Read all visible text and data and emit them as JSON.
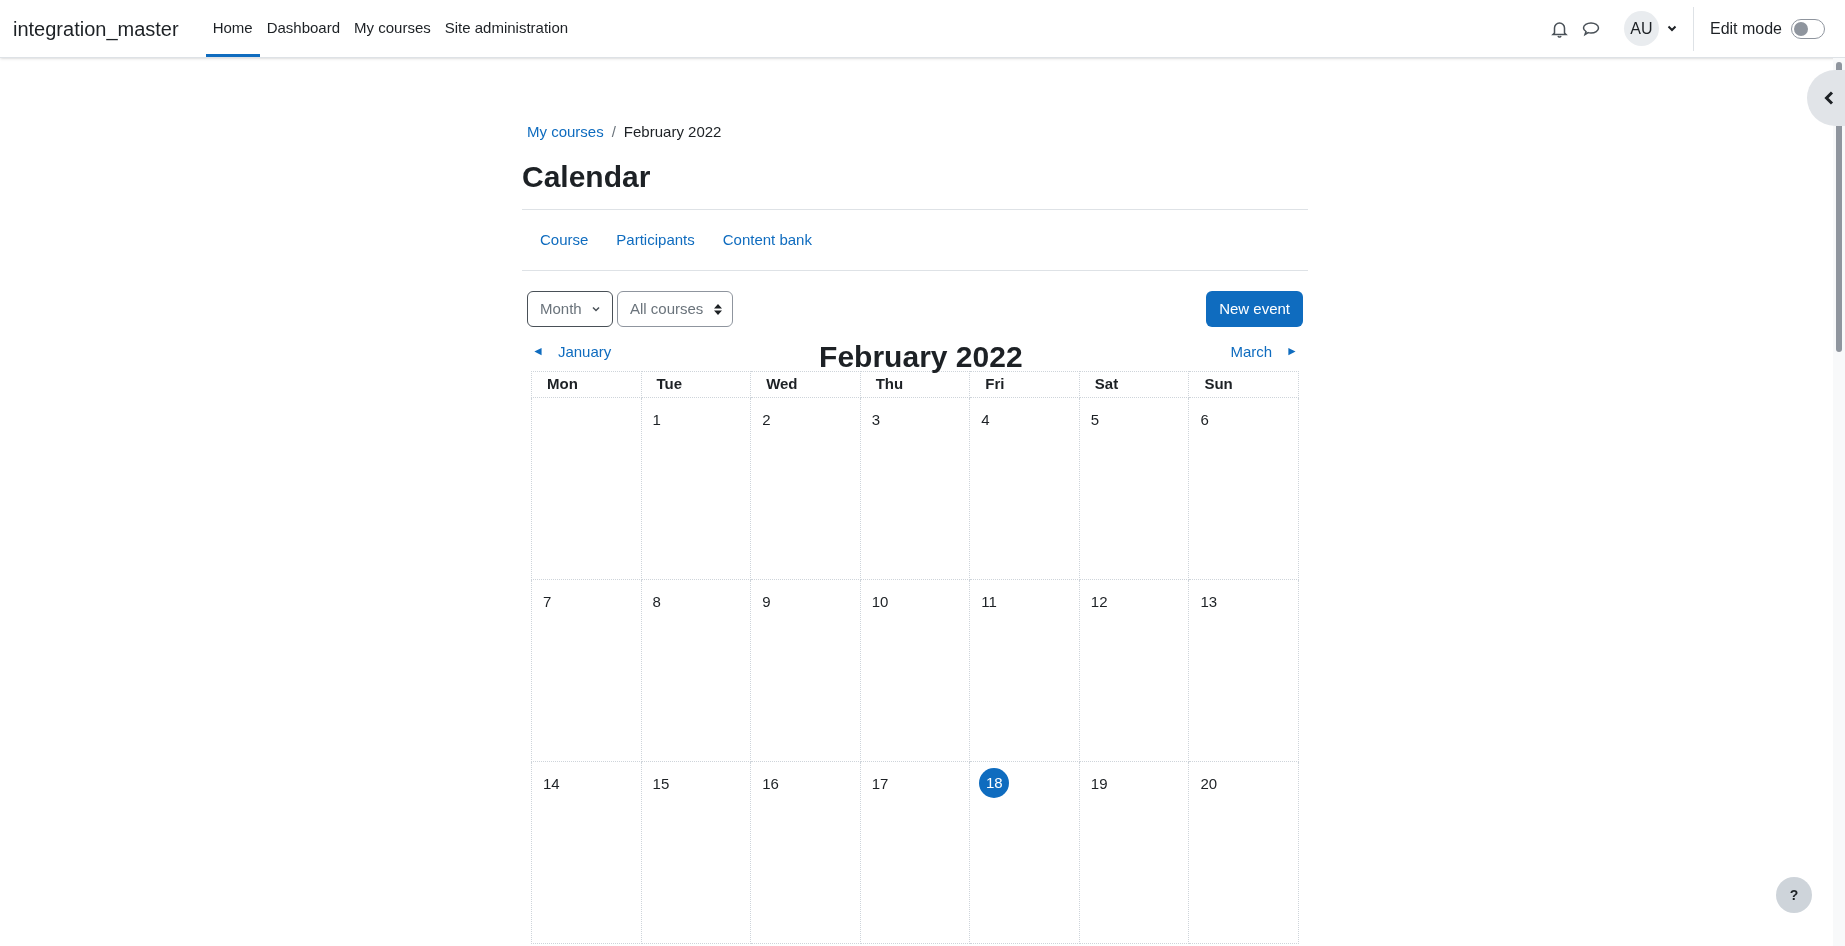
{
  "navbar": {
    "site_name": "integration_master",
    "links": [
      {
        "label": "Home",
        "selected": true
      },
      {
        "label": "Dashboard",
        "selected": false
      },
      {
        "label": "My courses",
        "selected": false
      },
      {
        "label": "Site administration",
        "selected": false
      }
    ],
    "user_initials": "AU",
    "edit_mode": {
      "label": "Edit mode",
      "on": false
    }
  },
  "breadcrumb": [
    {
      "label": "My courses",
      "kind": "link"
    },
    {
      "label": "February 2022",
      "kind": "current"
    }
  ],
  "breadcrumb_separator": "/",
  "heading": "Calendar",
  "secondary_nav": [
    {
      "label": "Course"
    },
    {
      "label": "Participants"
    },
    {
      "label": "Content bank"
    }
  ],
  "view_select": {
    "value": "Month"
  },
  "course_select": {
    "value": "All courses"
  },
  "new_event_button": "New event",
  "month_nav": {
    "prev_arrow": "◄",
    "prev": "January",
    "title": "February 2022",
    "next": "March",
    "next_arrow": "►"
  },
  "weekdays": [
    "Mon",
    "Tue",
    "Wed",
    "Thu",
    "Fri",
    "Sat",
    "Sun"
  ],
  "weeks": [
    [
      {
        "kind": "blank"
      },
      {
        "kind": "day",
        "label": "1",
        "today": false
      },
      {
        "kind": "day",
        "label": "2",
        "today": false
      },
      {
        "kind": "day",
        "label": "3",
        "today": false
      },
      {
        "kind": "day",
        "label": "4",
        "today": false
      },
      {
        "kind": "day",
        "label": "5",
        "today": false
      },
      {
        "kind": "day",
        "label": "6",
        "today": false
      }
    ],
    [
      {
        "kind": "day",
        "label": "7",
        "today": false
      },
      {
        "kind": "day",
        "label": "8",
        "today": false
      },
      {
        "kind": "day",
        "label": "9",
        "today": false
      },
      {
        "kind": "day",
        "label": "10",
        "today": false
      },
      {
        "kind": "day",
        "label": "11",
        "today": false
      },
      {
        "kind": "day",
        "label": "12",
        "today": false
      },
      {
        "kind": "day",
        "label": "13",
        "today": false
      }
    ],
    [
      {
        "kind": "day",
        "label": "14",
        "today": false
      },
      {
        "kind": "day",
        "label": "15",
        "today": false
      },
      {
        "kind": "day",
        "label": "16",
        "today": false
      },
      {
        "kind": "day",
        "label": "17",
        "today": false
      },
      {
        "kind": "day",
        "label": "18",
        "today": true
      },
      {
        "kind": "day",
        "label": "19",
        "today": false
      },
      {
        "kind": "day",
        "label": "20",
        "today": false
      }
    ]
  ],
  "help_button": "?"
}
